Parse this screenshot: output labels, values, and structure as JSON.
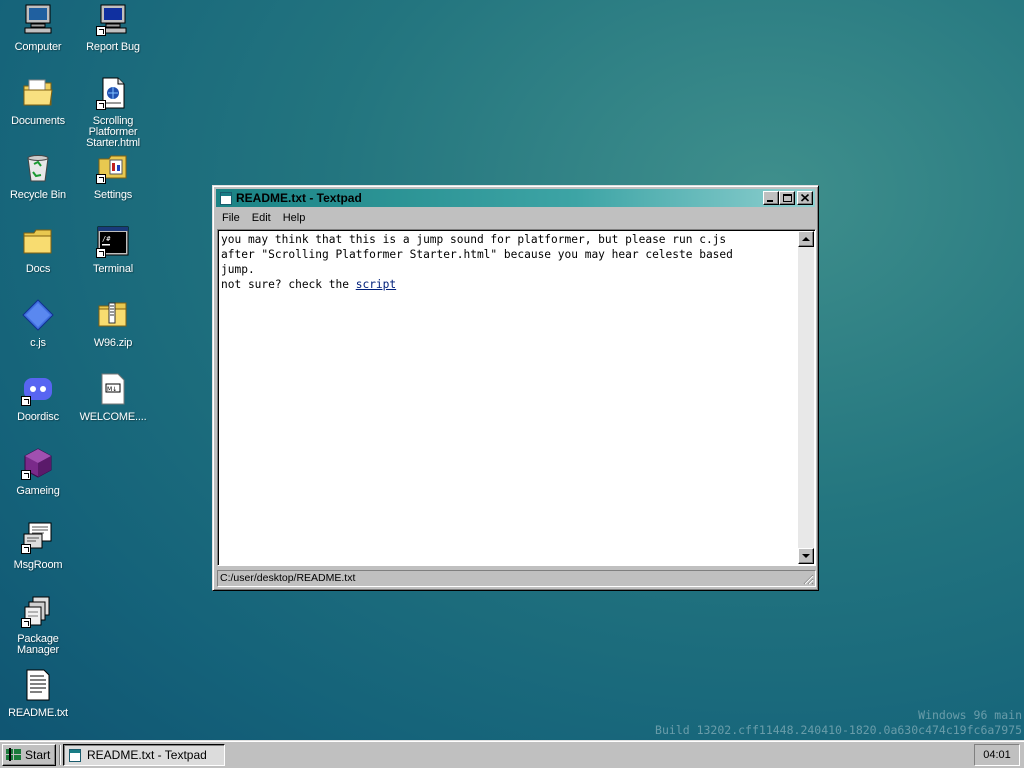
{
  "desktop": {
    "icons": [
      {
        "label": "Computer",
        "icon": "computer-icon"
      },
      {
        "label": "Report Bug",
        "icon": "report-bug-icon"
      },
      {
        "label": "Documents",
        "icon": "documents-folder-icon"
      },
      {
        "label": "Scrolling Platformer Starter.html",
        "icon": "html-file-icon"
      },
      {
        "label": "Recycle Bin",
        "icon": "recycle-bin-icon"
      },
      {
        "label": "Settings",
        "icon": "settings-icon"
      },
      {
        "label": "Docs",
        "icon": "folder-icon"
      },
      {
        "label": "Terminal",
        "icon": "terminal-icon"
      },
      {
        "label": "c.js",
        "icon": "js-file-icon"
      },
      {
        "label": "W96.zip",
        "icon": "zip-folder-icon"
      },
      {
        "label": "Doordisc",
        "icon": "doordisc-icon"
      },
      {
        "label": "WELCOME....",
        "icon": "markdown-file-icon"
      },
      {
        "label": "Gameing",
        "icon": "gameing-cube-icon"
      },
      {
        "label": "MsgRoom",
        "icon": "msgroom-icon"
      },
      {
        "label": "Package Manager",
        "icon": "package-manager-icon"
      },
      {
        "label": "README.txt",
        "icon": "text-file-icon"
      }
    ]
  },
  "window": {
    "title": "README.txt - Textpad",
    "menu": [
      "File",
      "Edit",
      "Help"
    ],
    "content": {
      "line1": "you may think that this is a jump sound for platformer, but please run c.js",
      "line2": "after \"Scrolling Platformer Starter.html\" because you may hear celeste based",
      "line3": "jump.",
      "line4_prefix": "not sure? check the ",
      "line4_link": "script"
    },
    "status_path": "C:/user/desktop/README.txt"
  },
  "watermark": {
    "line1": "Windows 96 main",
    "line2": "Build 13202.cff11448.240410-1820.0a630c474c19fc6a7975"
  },
  "taskbar": {
    "start_label": "Start",
    "task_label": "README.txt - Textpad",
    "clock": "04:01"
  },
  "colors": {
    "titlebar_start": "#1b8385",
    "titlebar_end": "#8fd0d0",
    "desktop_bg": "#1f6f7c"
  }
}
